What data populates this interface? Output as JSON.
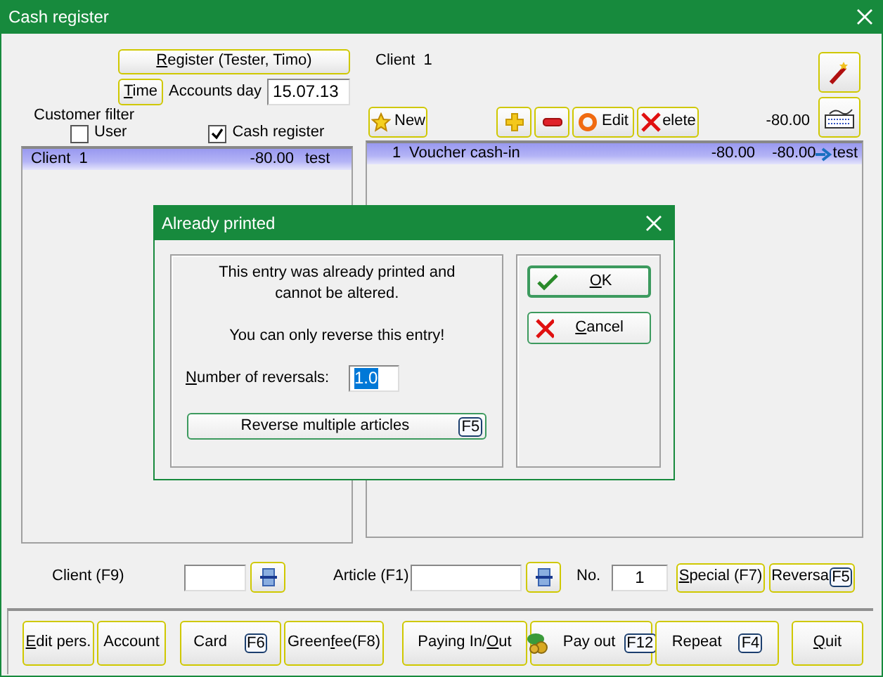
{
  "window": {
    "title": "Cash register"
  },
  "register_button": {
    "label": [
      {
        "text": "R",
        "underline": true
      },
      {
        "text": "egister (Tester, Timo)",
        "underline": false
      }
    ]
  },
  "time_button": {
    "label": [
      {
        "text": "T",
        "underline": true
      },
      {
        "text": "ime",
        "underline": false
      }
    ]
  },
  "accounts_day": {
    "label": "Accounts day",
    "value": "15.07.13"
  },
  "customer_filter": {
    "title": "Customer filter",
    "options": [
      {
        "label": "User",
        "checked": false
      },
      {
        "label": "Cash register",
        "checked": true
      }
    ]
  },
  "client_header": "Client  1",
  "toolbar": [
    {
      "kind": "new",
      "label": "New"
    },
    {
      "kind": "plus"
    },
    {
      "kind": "minus"
    },
    {
      "kind": "edit",
      "label": "Edit"
    },
    {
      "kind": "delete",
      "label": "elete"
    }
  ],
  "total": "-80.00",
  "client_list": {
    "rows": [
      {
        "cells": [
          "Client  1",
          "-80.00",
          "test"
        ],
        "selected": true
      }
    ]
  },
  "article_list": {
    "rows": [
      {
        "cells": [
          "1",
          "Voucher cash-in",
          "-80.00",
          "-80.00",
          "test"
        ],
        "selected": true
      }
    ]
  },
  "entry_row": {
    "client_label": "Client (F9)",
    "article_label": "Article (F1)",
    "no_label": "No.",
    "no_value": "1",
    "buttons": [
      {
        "label": [
          {
            "text": "S",
            "underline": true
          },
          {
            "text": "pecial (F7)",
            "underline": false
          }
        ]
      },
      {
        "label": "Reversa",
        "key": "F5"
      }
    ]
  },
  "bottom_buttons": [
    {
      "kind": "text",
      "label": [
        {
          "text": "E",
          "underline": true
        },
        {
          "text": "dit pers.",
          "underline": false
        }
      ]
    },
    {
      "kind": "text",
      "label": "Account"
    },
    {
      "kind": "key",
      "label": "Card",
      "key": "F6"
    },
    {
      "kind": "text",
      "label": [
        {
          "text": "Green",
          "underline": false
        },
        {
          "text": "f",
          "underline": true
        },
        {
          "text": "ee(F8)",
          "underline": false
        }
      ]
    },
    {
      "kind": "text",
      "label": [
        {
          "text": "Paying In/",
          "underline": false
        },
        {
          "text": "O",
          "underline": true
        },
        {
          "text": "ut",
          "underline": false
        }
      ]
    },
    {
      "kind": "icon",
      "label": "Pay out",
      "key": "F12"
    },
    {
      "kind": "key",
      "label": "Repeat",
      "key": "F4"
    },
    {
      "kind": "text",
      "label": [
        {
          "text": "Q",
          "underline": true
        },
        {
          "text": "uit",
          "underline": false
        }
      ]
    }
  ],
  "dialog": {
    "title": "Already printed",
    "message": "This entry was already printed and\ncannot be altered.",
    "note": "You can only reverse this entry!",
    "reversals": {
      "label": [
        {
          "text": "N",
          "underline": true
        },
        {
          "text": "umber of reversals:",
          "underline": false
        }
      ],
      "value": "1.0",
      "value_selected": true
    },
    "reverse_button": {
      "label": "Reverse multiple articles",
      "key": "F5"
    },
    "buttons": [
      {
        "kind": "ok",
        "label": [
          {
            "text": "O",
            "underline": true
          },
          {
            "text": "K",
            "underline": false
          }
        ],
        "focused": true
      },
      {
        "kind": "cancel",
        "label": [
          {
            "text": "C",
            "underline": true
          },
          {
            "text": "ancel",
            "underline": false
          }
        ],
        "focused": false
      }
    ]
  }
}
